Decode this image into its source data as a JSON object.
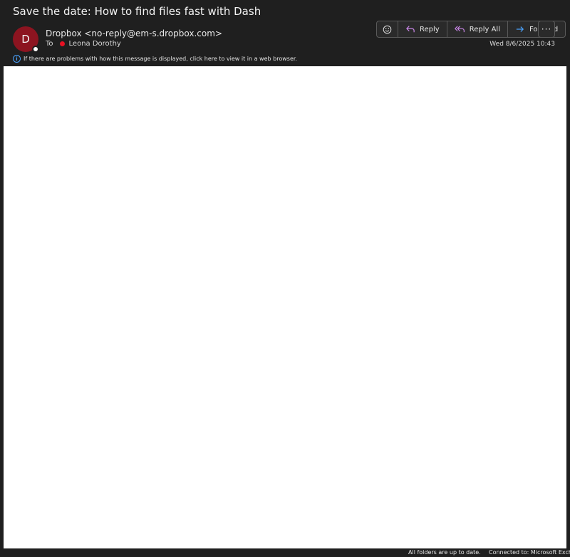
{
  "message": {
    "subject": "Save the date: How to find files fast with Dash",
    "avatar_initial": "D",
    "from": "Dropbox <no-reply@em-s.dropbox.com>",
    "to_label": "To",
    "to_name": "Leona Dorothy",
    "date": "Wed 8/6/2025 10:43",
    "info_text": "If there are problems with how this message is displayed, click here to view it in a web browser."
  },
  "toolbar": {
    "emoji_icon": "smiley-icon",
    "reply_label": "Reply",
    "reply_all_label": "Reply All",
    "forward_label": "Forward",
    "more_label": "···"
  },
  "status_bar": {
    "sync_status": "All folders are up to date.",
    "connection_status": "Connected to: Microsoft Exch"
  },
  "colors": {
    "avatar": "#8c1420",
    "presence": "#ffffff",
    "to_dot": "#e81123",
    "reply_icon": "#c785e5",
    "forward_icon": "#4aa3ff",
    "info_icon": "#4aa3ff"
  }
}
